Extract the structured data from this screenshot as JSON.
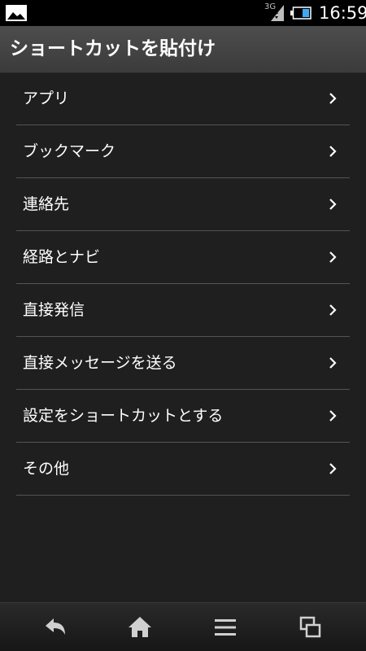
{
  "status_bar": {
    "network": "3G",
    "time": "16:59",
    "left_icon": "picture-icon",
    "battery_icon": "battery-icon"
  },
  "header": {
    "title": "ショートカットを貼付け"
  },
  "menu": {
    "items": [
      {
        "label": "アプリ",
        "icon": "chevron-right-icon"
      },
      {
        "label": "ブックマーク",
        "icon": "chevron-right-icon"
      },
      {
        "label": "連絡先",
        "icon": "chevron-right-icon"
      },
      {
        "label": "経路とナビ",
        "icon": "chevron-right-icon"
      },
      {
        "label": "直接発信",
        "icon": "chevron-right-icon"
      },
      {
        "label": "直接メッセージを送る",
        "icon": "chevron-right-icon"
      },
      {
        "label": "設定をショートカットとする",
        "icon": "chevron-right-icon"
      },
      {
        "label": "その他",
        "icon": "chevron-right-icon"
      }
    ]
  },
  "nav_bar": {
    "buttons": [
      "back-icon",
      "home-icon",
      "menu-icon",
      "recent-apps-icon"
    ]
  },
  "colors": {
    "background": "#1f1f1f",
    "title_bar": "#444444",
    "divider": "#545454",
    "text": "#ffffff"
  }
}
